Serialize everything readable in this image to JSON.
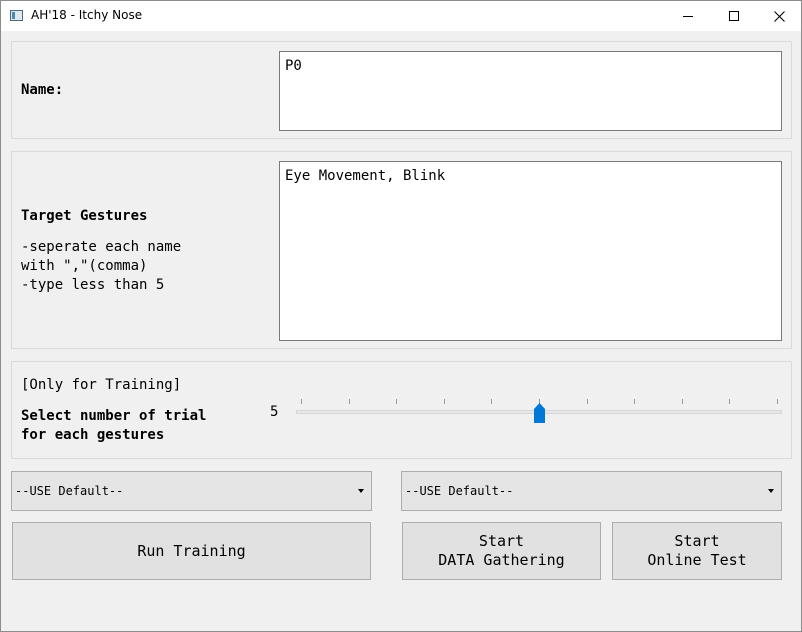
{
  "window": {
    "title": "AH'18 - Itchy Nose"
  },
  "name_section": {
    "label": "Name:",
    "value": "P0"
  },
  "gestures_section": {
    "title": "Target Gestures",
    "hint": "-seperate each name\nwith \",\"(comma)\n-type less than 5",
    "value": "Eye Movement, Blink"
  },
  "trial_section": {
    "tag": "[Only for Training]",
    "label": "Select number of trial\nfor each gestures",
    "value_text": "5",
    "slider": {
      "value": 5,
      "min": 0,
      "max": 10
    }
  },
  "combos": [
    {
      "selected": "--USE Default--"
    },
    {
      "selected": "--USE Default--"
    }
  ],
  "buttons": {
    "run_training": "Run Training",
    "data_gathering": "Start\nDATA Gathering",
    "online_test": "Start\nOnline Test"
  },
  "colors": {
    "accent": "#0078d7"
  }
}
